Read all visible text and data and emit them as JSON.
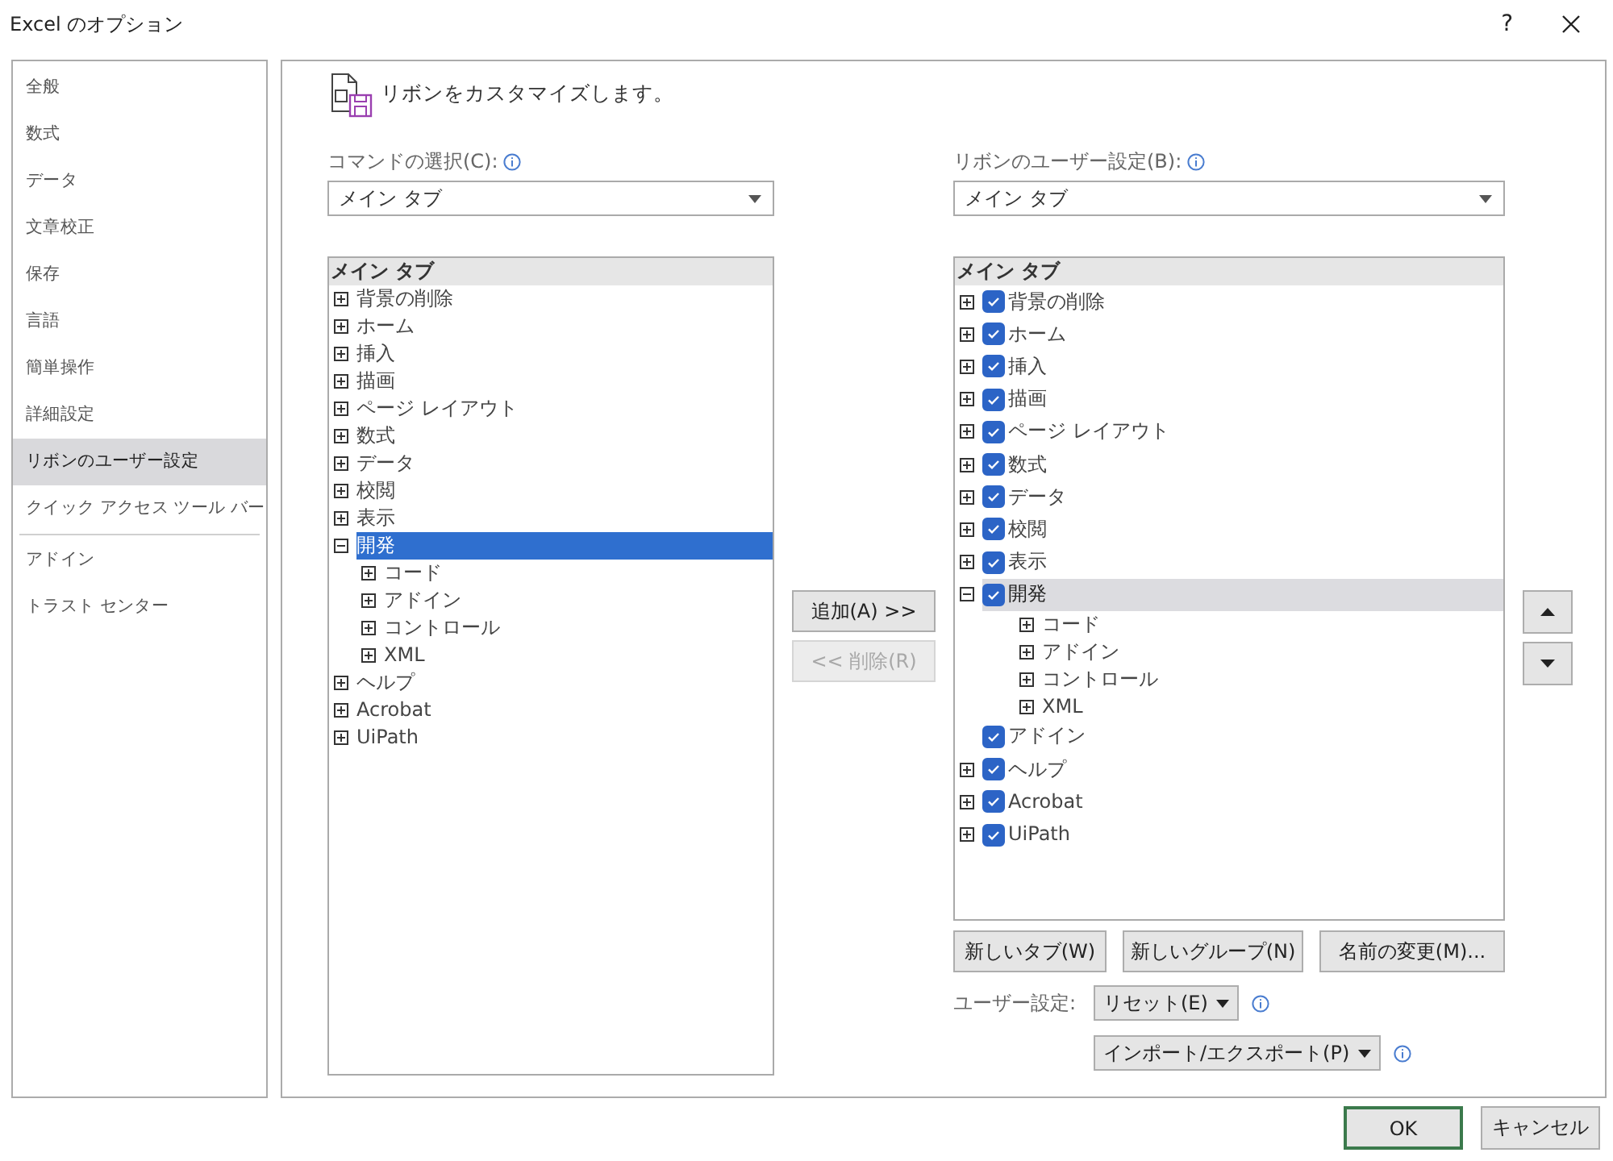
{
  "window": {
    "title": "Excel のオプション",
    "help": "?"
  },
  "sidebar": {
    "groups": [
      [
        {
          "label": "全般",
          "selected": false
        },
        {
          "label": "数式",
          "selected": false
        },
        {
          "label": "データ",
          "selected": false
        },
        {
          "label": "文章校正",
          "selected": false
        },
        {
          "label": "保存",
          "selected": false
        },
        {
          "label": "言語",
          "selected": false
        },
        {
          "label": "簡単操作",
          "selected": false
        },
        {
          "label": "詳細設定",
          "selected": false
        },
        {
          "label": "リボンのユーザー設定",
          "selected": true
        },
        {
          "label": "クイック アクセス ツール バー",
          "selected": false
        }
      ],
      [
        {
          "label": "アドイン",
          "selected": false
        },
        {
          "label": "トラスト センター",
          "selected": false
        }
      ]
    ]
  },
  "main": {
    "heading": "リボンをカスタマイズします。",
    "commands": {
      "label": "コマンドの選択(C):",
      "value": "メイン タブ",
      "list": {
        "header": "メイン タブ",
        "items": [
          {
            "label": "背景の削除",
            "expanded": false,
            "selected": false
          },
          {
            "label": "ホーム",
            "expanded": false,
            "selected": false
          },
          {
            "label": "挿入",
            "expanded": false,
            "selected": false
          },
          {
            "label": "描画",
            "expanded": false,
            "selected": false
          },
          {
            "label": "ページ レイアウト",
            "expanded": false,
            "selected": false
          },
          {
            "label": "数式",
            "expanded": false,
            "selected": false
          },
          {
            "label": "データ",
            "expanded": false,
            "selected": false
          },
          {
            "label": "校閲",
            "expanded": false,
            "selected": false
          },
          {
            "label": "表示",
            "expanded": false,
            "selected": false
          },
          {
            "label": "開発",
            "expanded": true,
            "selected": true,
            "children": [
              {
                "label": "コード",
                "expanded": false,
                "selected": false
              },
              {
                "label": "アドイン",
                "expanded": false,
                "selected": false
              },
              {
                "label": "コントロール",
                "expanded": false,
                "selected": false
              },
              {
                "label": "XML",
                "expanded": false,
                "selected": false
              }
            ]
          },
          {
            "label": "ヘルプ",
            "expanded": false,
            "selected": false
          },
          {
            "label": "Acrobat",
            "expanded": false,
            "selected": false
          },
          {
            "label": "UiPath",
            "expanded": false,
            "selected": false
          }
        ]
      }
    },
    "add_button": {
      "label": "追加(A) >>",
      "disabled": false
    },
    "remove_button": {
      "label": "<< 削除(R)",
      "disabled": true
    },
    "ribbon": {
      "label": "リボンのユーザー設定(B):",
      "value": "メイン タブ",
      "list": {
        "header": "メイン タブ",
        "items": [
          {
            "label": "背景の削除",
            "expanded": false,
            "checked": true,
            "selected": false
          },
          {
            "label": "ホーム",
            "expanded": false,
            "checked": true,
            "selected": false
          },
          {
            "label": "挿入",
            "expanded": false,
            "checked": true,
            "selected": false
          },
          {
            "label": "描画",
            "expanded": false,
            "checked": true,
            "selected": false
          },
          {
            "label": "ページ レイアウト",
            "expanded": false,
            "checked": true,
            "selected": false
          },
          {
            "label": "数式",
            "expanded": false,
            "checked": true,
            "selected": false
          },
          {
            "label": "データ",
            "expanded": false,
            "checked": true,
            "selected": false
          },
          {
            "label": "校閲",
            "expanded": false,
            "checked": true,
            "selected": false
          },
          {
            "label": "表示",
            "expanded": false,
            "checked": true,
            "selected": false
          },
          {
            "label": "開発",
            "expanded": true,
            "checked": true,
            "selected": true,
            "children": [
              {
                "label": "コード",
                "expanded": false,
                "selected": false
              },
              {
                "label": "アドイン",
                "expanded": false,
                "selected": false
              },
              {
                "label": "コントロール",
                "expanded": false,
                "selected": false
              },
              {
                "label": "XML",
                "expanded": false,
                "selected": false
              }
            ]
          },
          {
            "label": "アドイン",
            "checked": true,
            "selected": false
          },
          {
            "label": "ヘルプ",
            "expanded": false,
            "checked": true,
            "selected": false
          },
          {
            "label": "Acrobat",
            "expanded": false,
            "checked": true,
            "selected": false
          },
          {
            "label": "UiPath",
            "expanded": false,
            "checked": true,
            "selected": false
          }
        ]
      }
    },
    "buttons": [
      "新しいタブ(W)",
      "新しいグループ(N)",
      "名前の変更(M)..."
    ],
    "customize": {
      "label": "ユーザー設定:",
      "reset": "リセット(E)",
      "import_export": "インポート/エクスポート(P)"
    }
  },
  "footer": {
    "ok": "OK",
    "cancel": "キャンセル"
  }
}
